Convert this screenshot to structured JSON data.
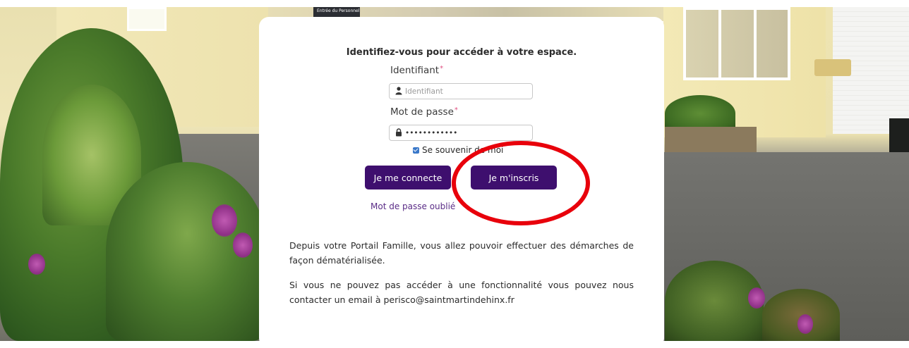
{
  "background": {
    "sign_text": "Entrée du Personnel"
  },
  "login": {
    "heading": "Identifiez-vous pour accéder à votre espace.",
    "username_label": "Identifiant",
    "required_mark": "*",
    "username_placeholder": "Identifiant",
    "password_label": "Mot de passe",
    "password_value": "••••••••••••",
    "remember_label": "Se souvenir de moi",
    "remember_checked": true,
    "login_button": "Je me connecte",
    "signup_button": "Je m'inscris",
    "forgot_link": "Mot de passe oublié",
    "icons": {
      "username": "user-icon",
      "password": "lock-icon"
    }
  },
  "info": {
    "paragraph1": "Depuis votre Portail Famille, vous allez pouvoir effectuer des démarches de façon dématérialisée.",
    "paragraph2": "Si vous ne pouvez pas accéder à une fonctionnalité vous pouvez nous contacter un email à perisco@saintmartindehinx.fr"
  },
  "colors": {
    "button_bg": "#3e0f6e",
    "link": "#5a2c86",
    "annotation": "#e8000b"
  }
}
